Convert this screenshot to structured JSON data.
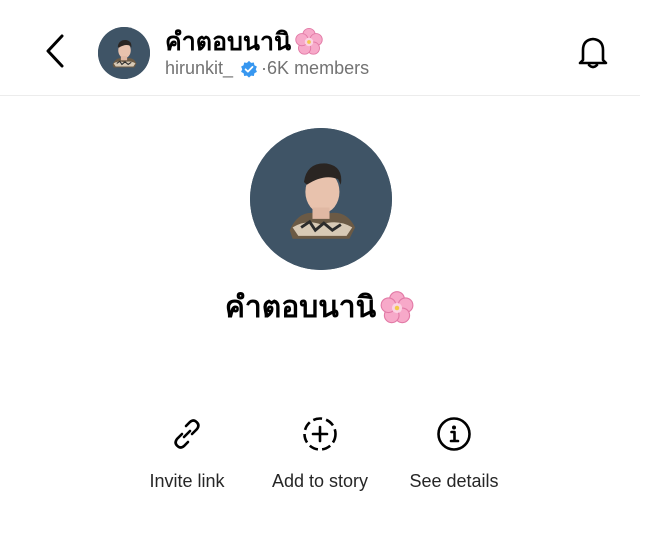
{
  "header": {
    "back_icon": "chevron-left-icon",
    "title": "คำตอบนานิ",
    "title_emoji": "cherry-blossom-icon",
    "owner": "hirunkit_",
    "verified_icon": "verified-badge-icon",
    "members": "6K members",
    "bell_icon": "bell-icon"
  },
  "profile": {
    "name": "คำตอบนานิ",
    "name_emoji": "cherry-blossom-icon",
    "avatar_bg": "#3f5466"
  },
  "actions": [
    {
      "label": "Invite link",
      "icon": "link-icon"
    },
    {
      "label": "Add to story",
      "icon": "add-story-icon"
    },
    {
      "label": "See details",
      "icon": "info-icon"
    }
  ],
  "colors": {
    "verified": "#3797f0",
    "secondary_text": "#737373",
    "flower": "#f7a8c8"
  }
}
